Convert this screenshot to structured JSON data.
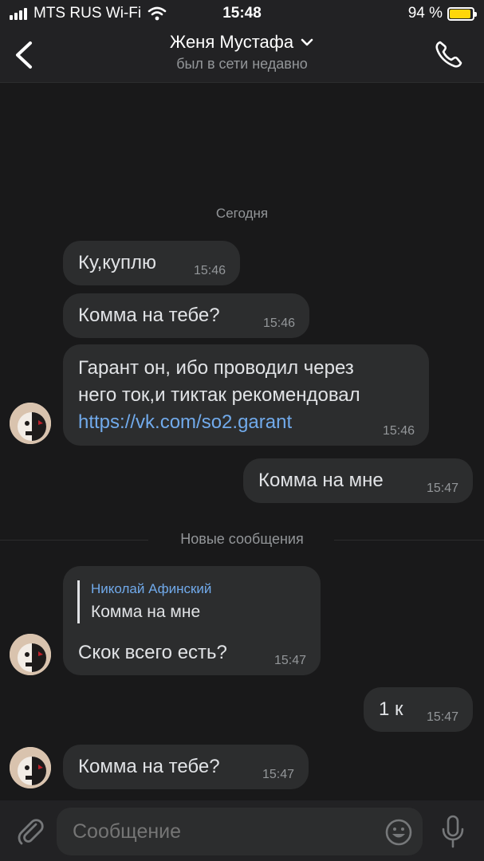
{
  "status_bar": {
    "carrier": "MTS RUS Wi-Fi",
    "time": "15:48",
    "battery": "94 %",
    "battery_level": 0.94
  },
  "header": {
    "name": "Женя Мустафа",
    "status": "был в сети недавно"
  },
  "date_label": "Сегодня",
  "messages": [
    {
      "text": "Ку,куплю",
      "time": "15:46"
    },
    {
      "text": "Комма на тебе?",
      "time": "15:46"
    },
    {
      "line1": "Гарант он, ибо проводил через",
      "line2": "него ток,и тиктак рекомендовал",
      "link": "https://vk.com/so2.garant",
      "time": "15:46"
    },
    {
      "text": "Комма на мне",
      "time": "15:47"
    },
    {
      "reply_name": "Николай Афинский",
      "reply_text": "Комма на мне",
      "text": "Скок всего есть?",
      "time": "15:47"
    },
    {
      "text": "1 к",
      "time": "15:47"
    },
    {
      "text": "Комма на тебе?",
      "time": "15:47"
    }
  ],
  "new_messages_label": "Новые сообщения",
  "composer": {
    "placeholder": "Сообщение"
  },
  "colors": {
    "background": "#19191a",
    "bubble": "#2c2d2e",
    "link": "#71aaeb",
    "battery": "#ffd60a"
  }
}
